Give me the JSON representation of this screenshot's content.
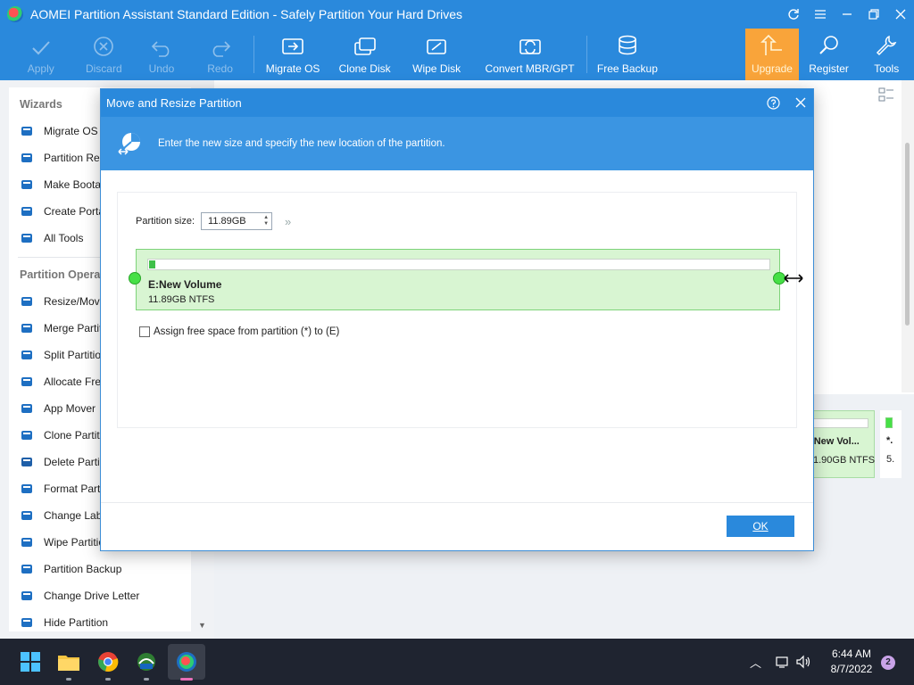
{
  "window": {
    "title": "AOMEI Partition Assistant Standard Edition - Safely Partition Your Hard Drives"
  },
  "toolbar": {
    "apply": "Apply",
    "discard": "Discard",
    "undo": "Undo",
    "redo": "Redo",
    "migrate_os": "Migrate OS",
    "clone_disk": "Clone Disk",
    "wipe_disk": "Wipe Disk",
    "convert": "Convert MBR/GPT",
    "free_backup": "Free Backup",
    "upgrade": "Upgrade",
    "register": "Register",
    "tools": "Tools"
  },
  "sidebar": {
    "wizards_header": "Wizards",
    "wizards": [
      {
        "label": "Migrate OS to",
        "icon": "migrate-icon"
      },
      {
        "label": "Partition Reco",
        "icon": "recovery-icon"
      },
      {
        "label": "Make Bootab",
        "icon": "bootable-icon"
      },
      {
        "label": "Create Porta",
        "icon": "portable-icon"
      },
      {
        "label": "All Tools",
        "icon": "grid-icon"
      }
    ],
    "operations_header": "Partition Operat",
    "operations": [
      {
        "label": "Resize/Move",
        "icon": "resize-icon"
      },
      {
        "label": "Merge Partiti",
        "icon": "merge-icon"
      },
      {
        "label": "Split Partition",
        "icon": "split-icon"
      },
      {
        "label": "Allocate Free",
        "icon": "allocate-icon"
      },
      {
        "label": "App Mover",
        "icon": "app-mover-icon"
      },
      {
        "label": "Clone Partitio",
        "icon": "clone-icon"
      },
      {
        "label": "Delete Partiti",
        "icon": "trash-icon"
      },
      {
        "label": "Format Partit",
        "icon": "format-icon"
      },
      {
        "label": "Change Labe",
        "icon": "label-icon"
      },
      {
        "label": "Wipe Partition",
        "icon": "wipe-icon"
      },
      {
        "label": "Partition Backup",
        "icon": "backup-icon"
      },
      {
        "label": "Change Drive Letter",
        "icon": "drive-letter-icon"
      },
      {
        "label": "Hide Partition",
        "icon": "hide-icon"
      }
    ]
  },
  "background_partition": {
    "name": ": New Vol...",
    "info": "1.90GB NTFS",
    "extra_name": "*.",
    "extra_info": "5."
  },
  "dialog": {
    "title": "Move and Resize Partition",
    "banner_text": "Enter the new size and specify the new location of the partition.",
    "size_label": "Partition size:",
    "size_value": "11.89GB",
    "partition_name": "E:New Volume",
    "partition_info": "11.89GB NTFS",
    "partition_used_fraction": 0.01,
    "assign_label": "Assign free space from partition (*) to (E)",
    "ok": "OK"
  },
  "taskbar": {
    "time": "6:44 AM",
    "date": "8/7/2022",
    "notifications": "2"
  },
  "colors": {
    "accent": "#2a89dc",
    "upgrade": "#f9a43a",
    "partition_fill": "#d8f5d2",
    "handle": "#46e046"
  }
}
